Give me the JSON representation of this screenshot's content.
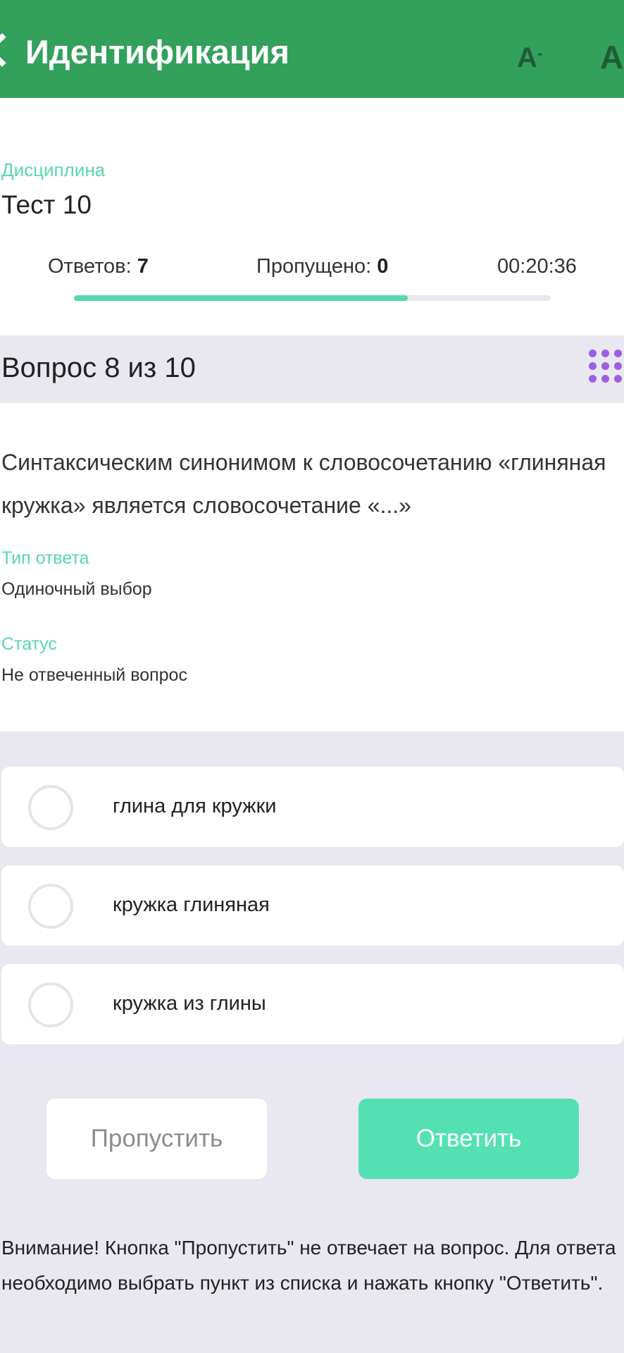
{
  "header": {
    "title": "Идентификация",
    "font_decrease_label": "A",
    "font_decrease_suffix": "-",
    "font_increase_label": "A"
  },
  "discipline": {
    "label": "Дисциплина",
    "value": "Тест 10"
  },
  "stats": {
    "answered_label": "Ответов:",
    "answered_count": "7",
    "skipped_label": "Пропущено:",
    "skipped_count": "0",
    "timer": "00:20:36",
    "progress_fraction": 0.7
  },
  "question": {
    "number_label": "Вопрос 8 из 10",
    "text": "Синтаксическим синонимом к словосочетанию «глиняная кружка» является словосочетание «...»",
    "answer_type_label": "Тип ответа",
    "answer_type_value": "Одиночный выбор",
    "status_label": "Статус",
    "status_value": "Не отвеченный вопрос"
  },
  "options": [
    {
      "label": "глина для кружки",
      "selected": false
    },
    {
      "label": "кружка глиняная",
      "selected": false
    },
    {
      "label": "кружка из глины",
      "selected": false
    }
  ],
  "buttons": {
    "skip_label": "Пропустить",
    "answer_label": "Ответить"
  },
  "notice": "Внимание! Кнопка \"Пропустить\" не отвечает на вопрос. Для ответа необходимо выбрать пункт из списка и нажать кнопку \"Ответить\".",
  "colors": {
    "header": "#33a05c",
    "accent": "#56d8ae",
    "answer_button": "#55e0b3",
    "grid_icon": "#9b5fe0",
    "band": "#e9e7ef"
  }
}
